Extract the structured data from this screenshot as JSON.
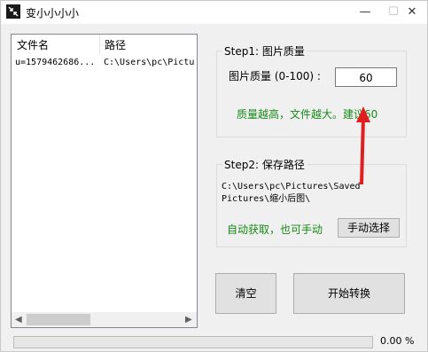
{
  "window": {
    "title": "变小小小小",
    "minimize_glyph": "—",
    "maximize_glyph": "☐",
    "close_glyph": "✕"
  },
  "file_list": {
    "columns": [
      "文件名",
      "路径"
    ],
    "rows": [
      {
        "name": "u=1579462686...",
        "path": "C:\\Users\\pc\\Pictu"
      }
    ],
    "scroll_left": "◀",
    "scroll_right": "▶"
  },
  "step1": {
    "legend": "Step1: 图片质量",
    "quality_label": "图片质量 (0-100) :",
    "quality_value": "60",
    "hint": "质量越高，文件越大。建议60"
  },
  "step2": {
    "legend": "Step2: 保存路径",
    "path_text": "C:\\Users\\pc\\Pictures\\Saved Pictures\\缩小后图\\",
    "hint": "自动获取，也可手动",
    "manual_button": "手动选择"
  },
  "actions": {
    "clear_button": "清空",
    "start_button": "开始转换"
  },
  "progress": {
    "value_percent": 0,
    "text": "0.00 %",
    "fill_color": "#06b025"
  },
  "colors": {
    "hint_green": "#178a17",
    "arrow_red": "#e02020"
  },
  "icons": {
    "app": "compress-arrows-icon",
    "annotation": "red-arrow"
  }
}
